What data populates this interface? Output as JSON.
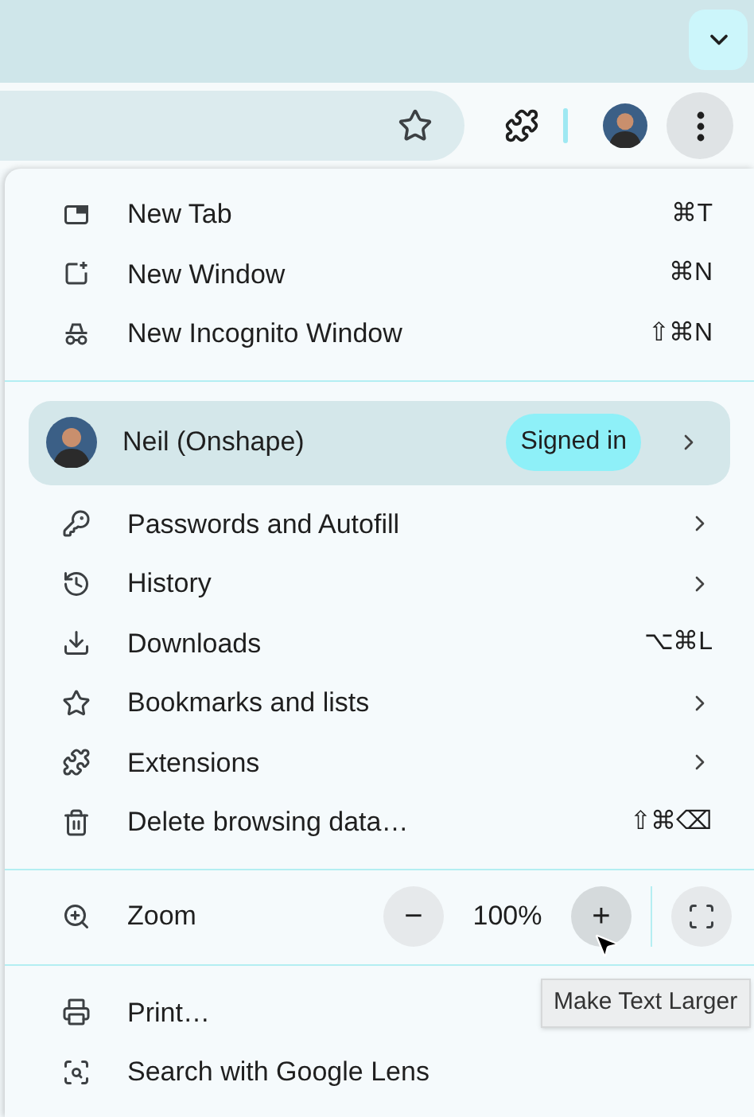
{
  "menu": {
    "groups": [
      {
        "divider_before": false,
        "items": [
          {
            "kind": "item",
            "label": "New Tab",
            "shortcut": "⌘T"
          },
          {
            "kind": "item",
            "label": "New Window",
            "shortcut": "⌘N"
          },
          {
            "kind": "item",
            "label": "New Incognito Window",
            "shortcut": "⇧⌘N"
          }
        ]
      },
      {
        "divider_before": true,
        "items": [
          {
            "kind": "profile",
            "label": "Neil (Onshape)",
            "badge": "Signed in",
            "submenu": true
          }
        ]
      },
      {
        "divider_before": false,
        "items": [
          {
            "kind": "item",
            "label": "Passwords and Autofill",
            "submenu": true
          },
          {
            "kind": "item",
            "label": "History",
            "submenu": true
          },
          {
            "kind": "item",
            "label": "Downloads",
            "shortcut": "⌥⌘L"
          },
          {
            "kind": "item",
            "label": "Bookmarks and lists",
            "submenu": true
          },
          {
            "kind": "item",
            "label": "Extensions",
            "submenu": true
          },
          {
            "kind": "item",
            "label": "Delete browsing data…",
            "shortcut": "⇧⌘⌫"
          }
        ]
      },
      {
        "divider_before": true,
        "items": [
          {
            "kind": "zoom",
            "label": "Zoom",
            "minus": "−",
            "value": "100%",
            "plus": "+",
            "plus_hovered": true
          }
        ]
      },
      {
        "divider_before": true,
        "items": [
          {
            "kind": "item",
            "label": "Print…"
          },
          {
            "kind": "item",
            "label": "Search with Google Lens"
          }
        ]
      }
    ]
  },
  "tooltip": "Make Text Larger"
}
